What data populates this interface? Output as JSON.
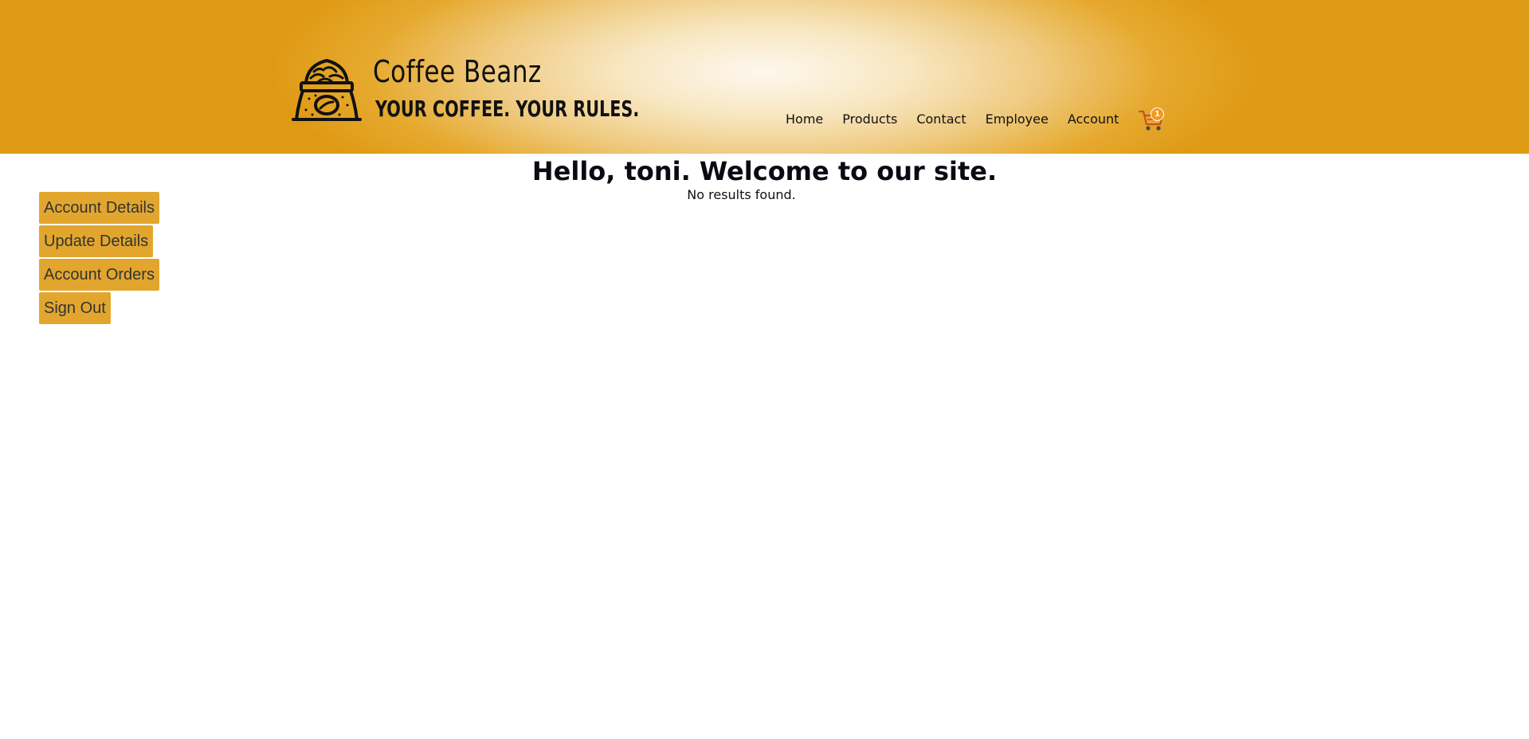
{
  "brand": {
    "name": "Coffee Beanz",
    "tagline": "YOUR COFFEE. YOUR RULES."
  },
  "nav": {
    "items": [
      "Home",
      "Products",
      "Contact",
      "Employee",
      "Account"
    ]
  },
  "cart": {
    "count": "1",
    "icon": "shopping-cart-icon"
  },
  "main": {
    "welcome": "Hello, toni. Welcome to our site.",
    "no_results": "No results found."
  },
  "side_menu": {
    "items": [
      "Account Details",
      "Update Details",
      "Account Orders",
      "Sign Out"
    ]
  },
  "colors": {
    "accent": "#e2a62e",
    "header_edge": "#df9a15",
    "header_center": "#fdf8ee",
    "badge": "#f29a1f"
  }
}
